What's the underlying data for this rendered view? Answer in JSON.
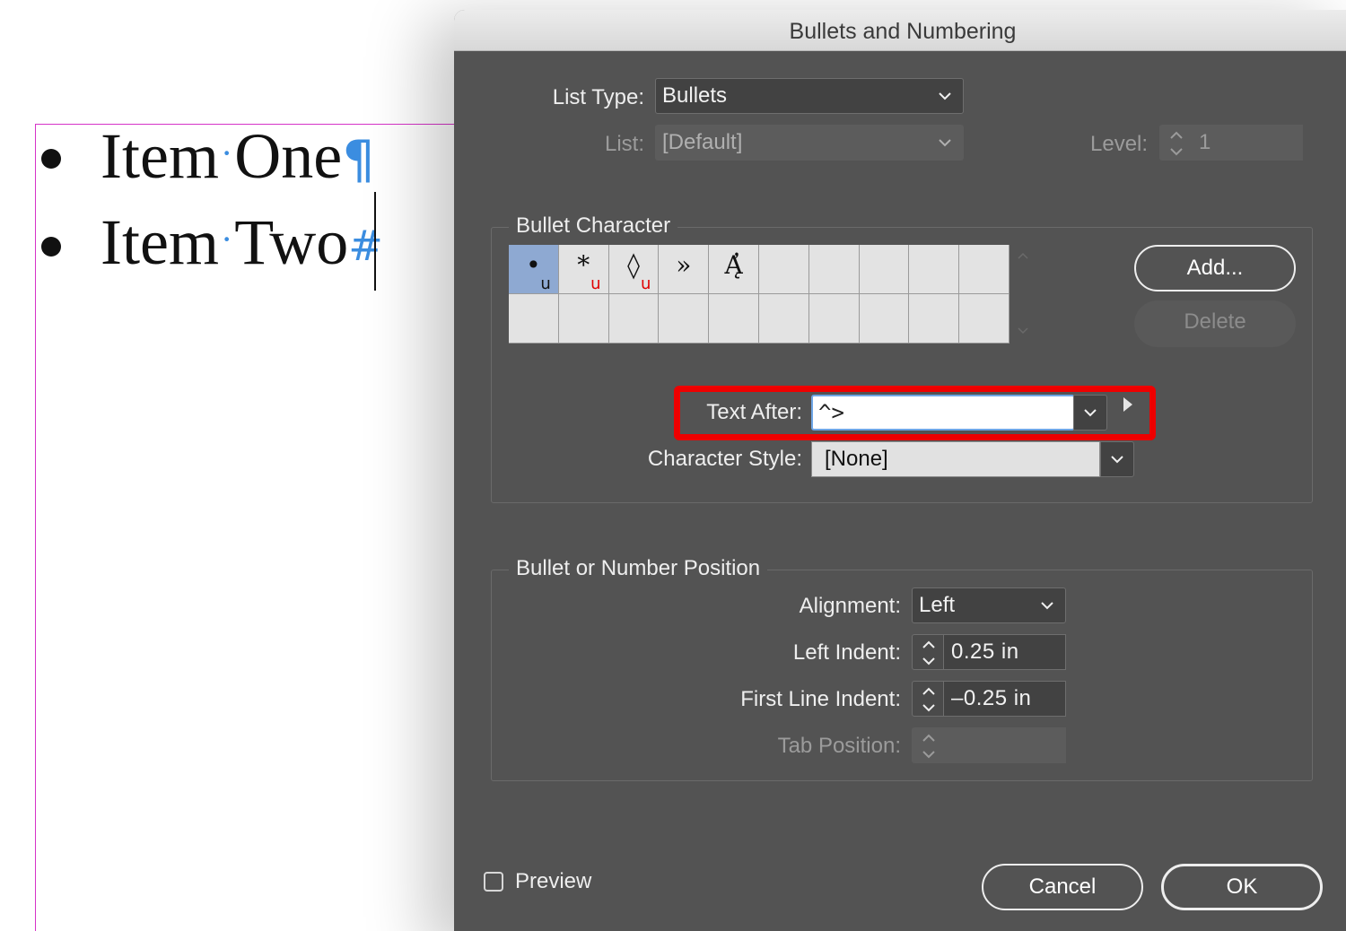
{
  "document": {
    "items": [
      {
        "first_word": "Item",
        "second_word": "One",
        "end_mark": "¶"
      },
      {
        "first_word": "Item",
        "second_word": "Two",
        "end_mark": "#"
      }
    ],
    "space_mark": "·"
  },
  "dialog": {
    "title": "Bullets and Numbering",
    "list_type": {
      "label": "List Type:",
      "value": "Bullets"
    },
    "list": {
      "label": "List:",
      "value": "[Default]"
    },
    "level": {
      "label": "Level:",
      "value": "1"
    },
    "bullet_character": {
      "title": "Bullet Character",
      "glyphs": [
        {
          "char": "•",
          "flag": "u",
          "flag_color": "#111111",
          "selected": true
        },
        {
          "char": "*",
          "flag": "u",
          "flag_color": "#e00000",
          "selected": false
        },
        {
          "char": "◊",
          "flag": "u",
          "flag_color": "#e00000",
          "selected": false
        },
        {
          "char": "»",
          "flag": "",
          "flag_color": "#111111",
          "selected": false
        },
        {
          "char": "Ą̓",
          "flag": "",
          "flag_color": "#111111",
          "selected": false
        }
      ],
      "add_label": "Add...",
      "delete_label": "Delete",
      "text_after": {
        "label": "Text After:",
        "value": "^>"
      },
      "character_style": {
        "label": "Character Style:",
        "value": "[None]"
      }
    },
    "position": {
      "title": "Bullet or Number Position",
      "alignment": {
        "label": "Alignment:",
        "value": "Left"
      },
      "left_indent": {
        "label": "Left Indent:",
        "value": "0.25 in"
      },
      "first_line_indent": {
        "label": "First Line Indent:",
        "value": "–0.25 in"
      },
      "tab_position": {
        "label": "Tab Position:",
        "value": ""
      }
    },
    "preview": {
      "label": "Preview",
      "checked": false
    },
    "cancel_label": "Cancel",
    "ok_label": "OK"
  },
  "colors": {
    "dialog_bg": "#535353",
    "highlight": "#ee0000",
    "selected_cell": "#8ea9d2",
    "hidden_chars": "#3b8de0",
    "frame_edge": "#d633c8"
  }
}
